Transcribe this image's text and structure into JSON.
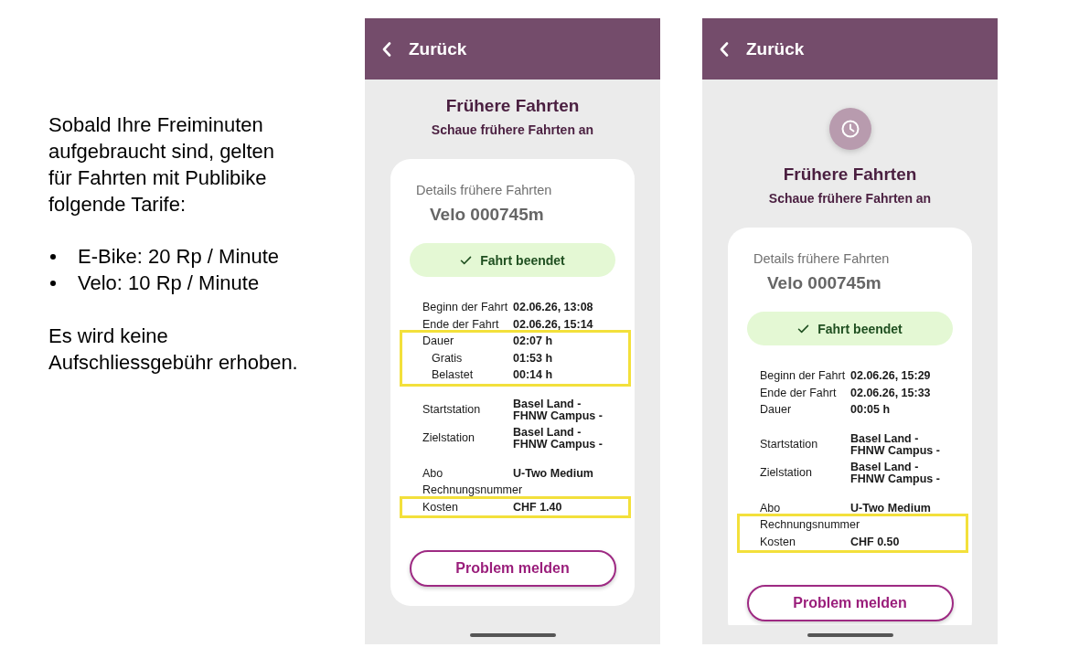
{
  "info_text": {
    "intro": "Sobald Ihre Freiminuten aufgebraucht sind, gelten für Fahrten mit Publibike folgende Tarife:",
    "tariffs": [
      "E-Bike: 20 Rp / Minute",
      "Velo: 10 Rp / Minute"
    ],
    "note": "Es wird keine Aufschliessgebühr erhoben."
  },
  "phones": [
    {
      "scrolled": true,
      "back_label": "Zurück",
      "title": "Frühere Fahrten",
      "subtitle": "Schaue frühere Fahrten an",
      "card": {
        "caption": "Details frühere Fahrten",
        "vehicle": "Velo 000745m",
        "status": "Fahrt beendet",
        "detail_groups": [
          [
            {
              "label": "Beginn der Fahrt",
              "value": "02.06.26, 13:08",
              "highlighted": false
            },
            {
              "label": "Ende der Fahrt",
              "value": "02.06.26, 15:14",
              "highlighted": false
            },
            {
              "label": "Dauer",
              "value": "02:07 h",
              "highlighted": true,
              "children": [
                {
                  "label": "Gratis",
                  "value": "01:53 h"
                },
                {
                  "label": "Belastet",
                  "value": "00:14 h"
                }
              ]
            }
          ],
          [
            {
              "label": "Startstation",
              "value": "Basel Land -\nFHNW Campus -",
              "highlighted": false
            },
            {
              "label": "Zielstation",
              "value": "Basel Land -\nFHNW Campus -",
              "highlighted": false
            }
          ],
          [
            {
              "label": "Abo",
              "value": "U-Two Medium",
              "highlighted": false
            },
            {
              "label": "Rechnungsnummer",
              "highlighted": false
            },
            {
              "label": "Kosten",
              "value": "CHF 1.40",
              "highlighted": true
            }
          ]
        ],
        "button": "Problem melden"
      }
    },
    {
      "scrolled": false,
      "back_label": "Zurück",
      "title": "Frühere Fahrten",
      "subtitle": "Schaue frühere Fahrten an",
      "card": {
        "caption": "Details frühere Fahrten",
        "vehicle": "Velo 000745m",
        "status": "Fahrt beendet",
        "detail_groups": [
          [
            {
              "label": "Beginn der Fahrt",
              "value": "02.06.26, 15:29",
              "highlighted": false
            },
            {
              "label": "Ende der Fahrt",
              "value": "02.06.26, 15:33",
              "highlighted": false
            },
            {
              "label": "Dauer",
              "value": "00:05 h",
              "highlighted": false
            }
          ],
          [
            {
              "label": "Startstation",
              "value": "Basel Land -\nFHNW Campus -",
              "highlighted": false
            },
            {
              "label": "Zielstation",
              "value": "Basel Land -\nFHNW Campus -",
              "highlighted": false
            }
          ],
          [
            {
              "label": "Abo",
              "value": "U-Two Medium",
              "highlighted": false
            },
            {
              "label": "Rechnungsnummer",
              "highlighted": true
            },
            {
              "label": "Kosten",
              "value": "CHF 0.50",
              "highlighted": true
            }
          ]
        ],
        "button": "Problem melden"
      }
    }
  ]
}
